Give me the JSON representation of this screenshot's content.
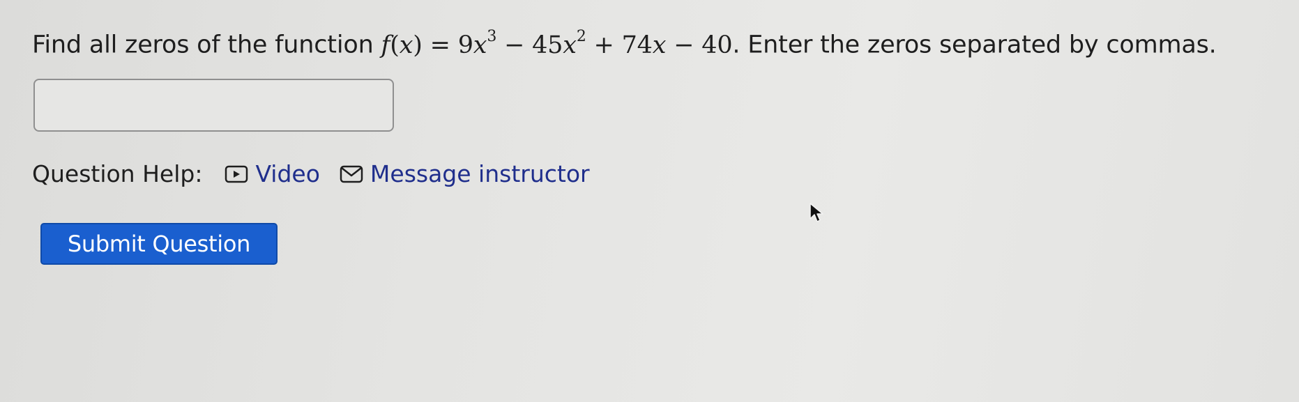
{
  "question": {
    "prefix": "Find all zeros of the function ",
    "math": {
      "f": "f",
      "open": "(",
      "x1": "x",
      "close_eq": ") = 9",
      "x2": "x",
      "exp1": "3",
      "mid1": " − 45",
      "x3": "x",
      "exp2": "2",
      "mid2": " + 74",
      "x4": "x",
      "mid3": " − 40"
    },
    "suffix": ". Enter the zeros separated by commas."
  },
  "answer": {
    "value": ""
  },
  "help": {
    "label": "Question Help:",
    "video_label": "Video",
    "message_label": "Message instructor"
  },
  "submit": {
    "label": "Submit Question"
  },
  "colors": {
    "link": "#1f2e8c",
    "button": "#1a5fcf"
  },
  "icons": {
    "video": "video-play-icon",
    "message": "envelope-icon",
    "cursor": "mouse-pointer-icon"
  }
}
